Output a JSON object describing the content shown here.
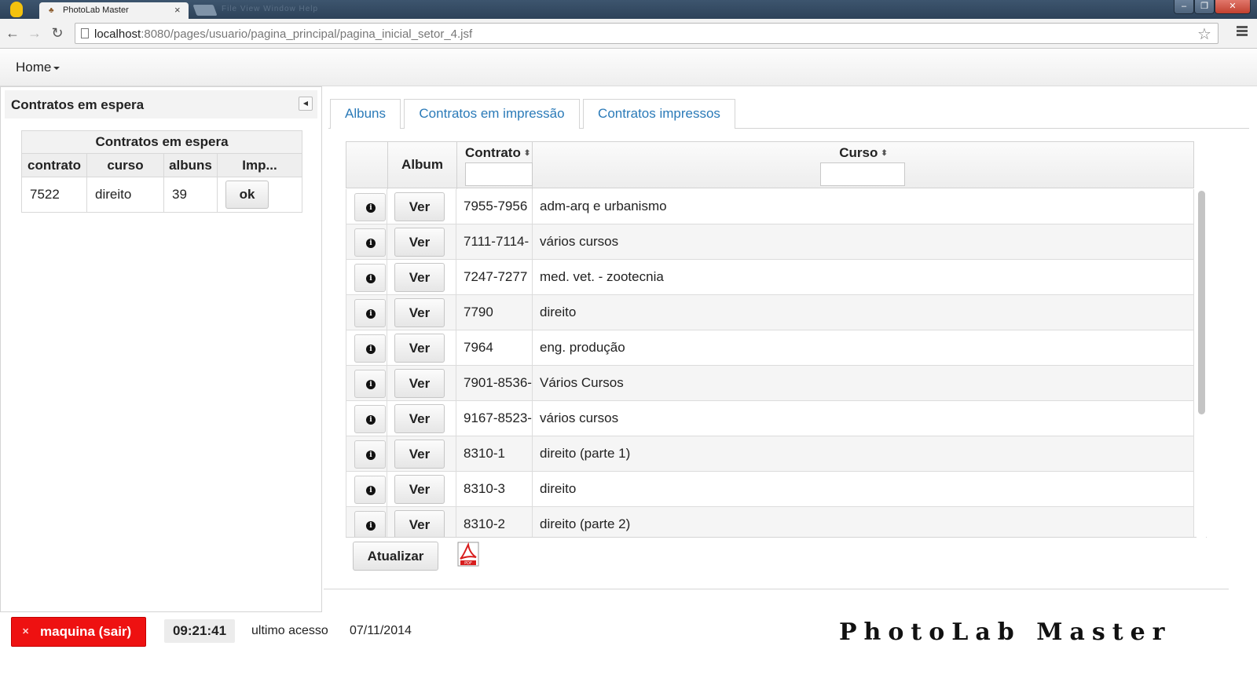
{
  "browser": {
    "tab_title": "PhotoLab Master",
    "tab_close": "×",
    "ghost_menu": "File View Window Help",
    "url_host": "localhost",
    "url_path": ":8080/pages/usuario/pagina_principal/pagina_inicial_setor_4.jsf"
  },
  "menubar": {
    "home_label": "Home"
  },
  "left_panel": {
    "title": "Contratos em espera",
    "table": {
      "caption": "Contratos em espera",
      "columns": [
        "contrato",
        "curso",
        "albuns",
        "Imp..."
      ],
      "rows": [
        {
          "contrato": "7522",
          "curso": "direito",
          "albuns": "39",
          "action": "ok"
        }
      ]
    }
  },
  "tabs": [
    "Albuns",
    "Contratos em impressão",
    "Contratos impressos"
  ],
  "grid": {
    "columns": {
      "album": "Album",
      "contrato": "Contrato",
      "curso": "Curso"
    },
    "ver_label": "Ver",
    "rows": [
      {
        "contrato": "7955-7956",
        "curso": "adm-arq e urbanismo"
      },
      {
        "contrato": "7111-7114-",
        "curso": "vários cursos"
      },
      {
        "contrato": "7247-7277",
        "curso": "med. vet. - zootecnia"
      },
      {
        "contrato": "7790",
        "curso": "direito"
      },
      {
        "contrato": "7964",
        "curso": "eng. produção"
      },
      {
        "contrato": "7901-8536-",
        "curso": "Vários Cursos"
      },
      {
        "contrato": "9167-8523-",
        "curso": "vários cursos"
      },
      {
        "contrato": "8310-1",
        "curso": "direito (parte 1)"
      },
      {
        "contrato": "8310-3",
        "curso": "direito"
      },
      {
        "contrato": "8310-2",
        "curso": "direito (parte 2)"
      }
    ]
  },
  "actions": {
    "refresh_label": "Atualizar"
  },
  "footer": {
    "logout_label": "maquina (sair)",
    "clock": "09:21:41",
    "last_access_label": "ultimo acesso",
    "last_access_date": "07/11/2014",
    "brand": "PhotoLab Master"
  },
  "colors": {
    "accent_link": "#2a7ab8",
    "logout_red": "#ee1111"
  },
  "icons": [
    "chrome-logo-icon",
    "back-arrow-icon",
    "forward-arrow-icon",
    "reload-icon",
    "page-icon",
    "star-icon",
    "menu-icon",
    "collapse-icon",
    "sort-icon",
    "info-icon",
    "pdf-icon",
    "close-icon"
  ]
}
